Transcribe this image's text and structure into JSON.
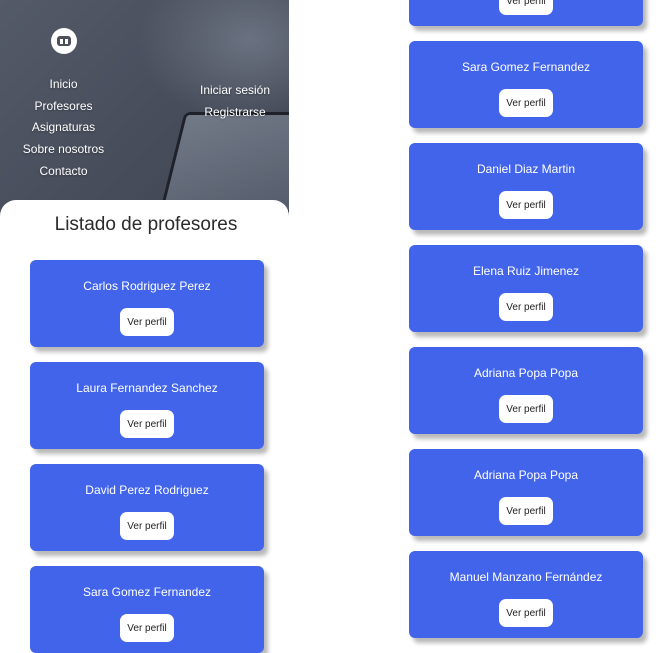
{
  "nav": {
    "items": [
      "Inicio",
      "Profesores",
      "Asignaturas",
      "Sobre nosotros",
      "Contacto"
    ]
  },
  "auth": {
    "login": "Iniciar sesión",
    "register": "Registrarse"
  },
  "page_title": "Listado de profesores",
  "profile_button": "Ver perfil",
  "left_teachers": [
    "Carlos Rodriguez Perez",
    "Laura Fernandez Sanchez",
    "David Perez Rodriguez",
    "Sara Gomez Fernandez"
  ],
  "right_teachers": [
    "Sara Gomez Fernandez",
    "Daniel Diaz Martin",
    "Elena Ruiz Jimenez",
    "Adriana Popa Popa",
    "Adriana Popa Popa",
    "Manuel Manzano Fernández"
  ],
  "colors": {
    "card": "#4264ea",
    "button": "#ffffff"
  }
}
